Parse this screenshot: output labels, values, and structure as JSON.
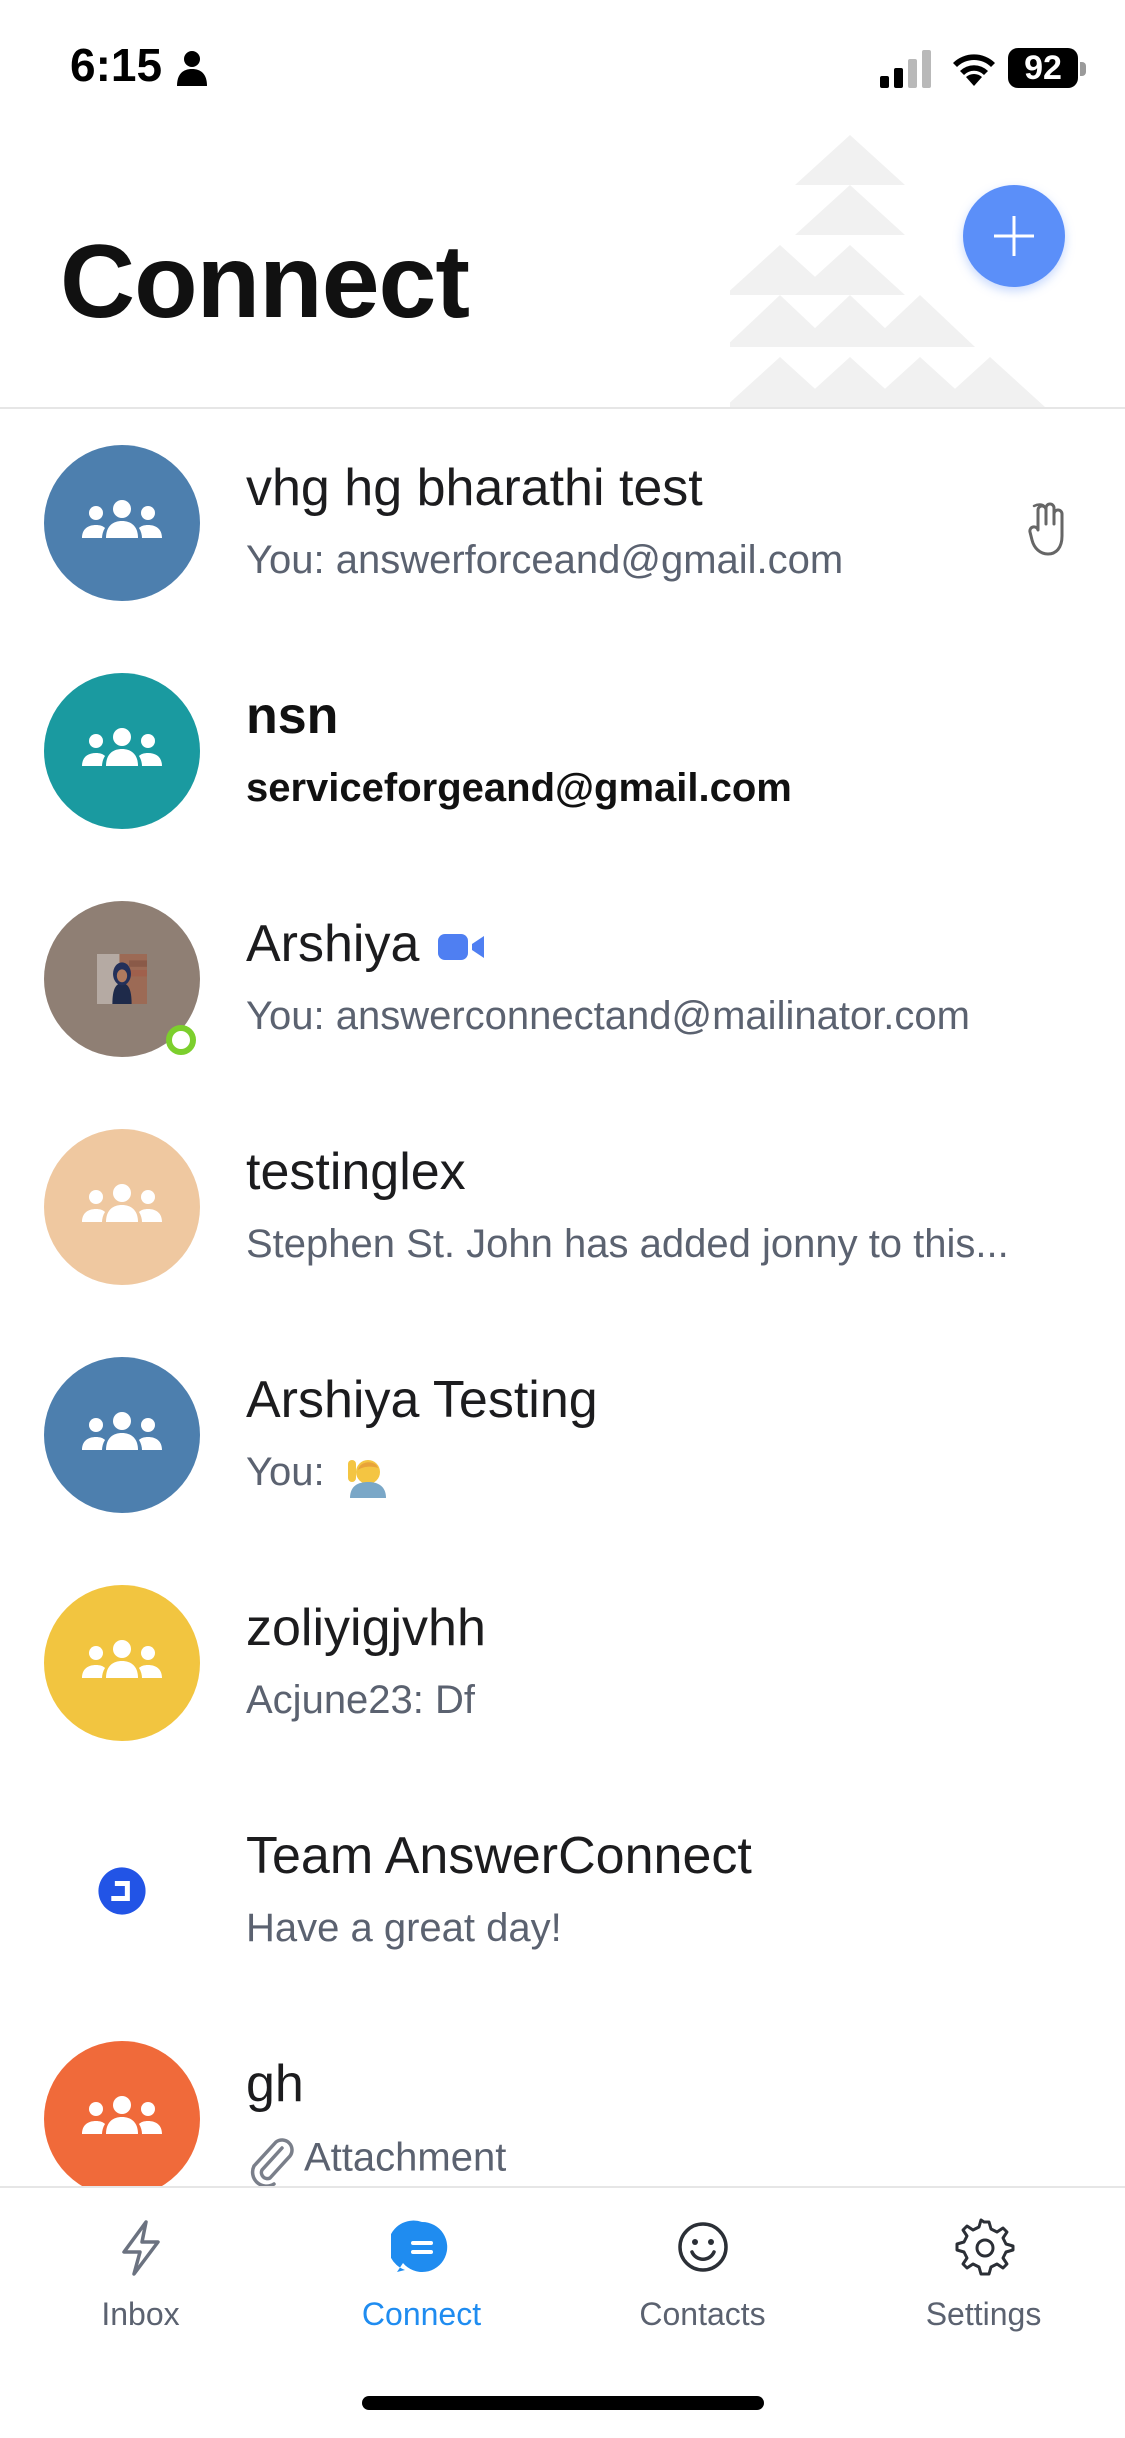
{
  "status_bar": {
    "time": "6:15",
    "battery": "92"
  },
  "header": {
    "title": "Connect"
  },
  "chats": [
    {
      "title": "vhg hg bharathi test",
      "preview": "You: answerforceand@gmail.com",
      "avatar_color": "#4d7fae"
    },
    {
      "title": "nsn",
      "preview": "serviceforgeand@gmail.com",
      "avatar_color": "#1a9aa0",
      "unread": true
    },
    {
      "title": "Arshiya",
      "preview": "You: answerconnectand@mailinator.com",
      "online": true
    },
    {
      "title": "testinglex",
      "preview": "Stephen St. John has added jonny to this...",
      "avatar_color": "#efc8a0"
    },
    {
      "title": "Arshiya Testing",
      "preview": "You:",
      "avatar_color": "#4d7fae"
    },
    {
      "title": "zoliyigjvhh",
      "preview": "Acjune23: Df",
      "avatar_color": "#f2c540"
    },
    {
      "title": "Team AnswerConnect",
      "preview": "Have a great day!",
      "avatar_color": "#2254e6"
    },
    {
      "title": "gh",
      "preview": "Attachment",
      "avatar_color": "#f06a3a"
    }
  ],
  "tabs": [
    {
      "label": "Inbox",
      "icon": "bolt-icon"
    },
    {
      "label": "Connect",
      "icon": "chat-bubble-icon",
      "active": true
    },
    {
      "label": "Contacts",
      "icon": "smiley-icon"
    },
    {
      "label": "Settings",
      "icon": "gear-icon"
    }
  ],
  "colors": {
    "accent": "#1f8cf0",
    "add_button": "#5b8ff9",
    "online": "#7ccf2d"
  }
}
